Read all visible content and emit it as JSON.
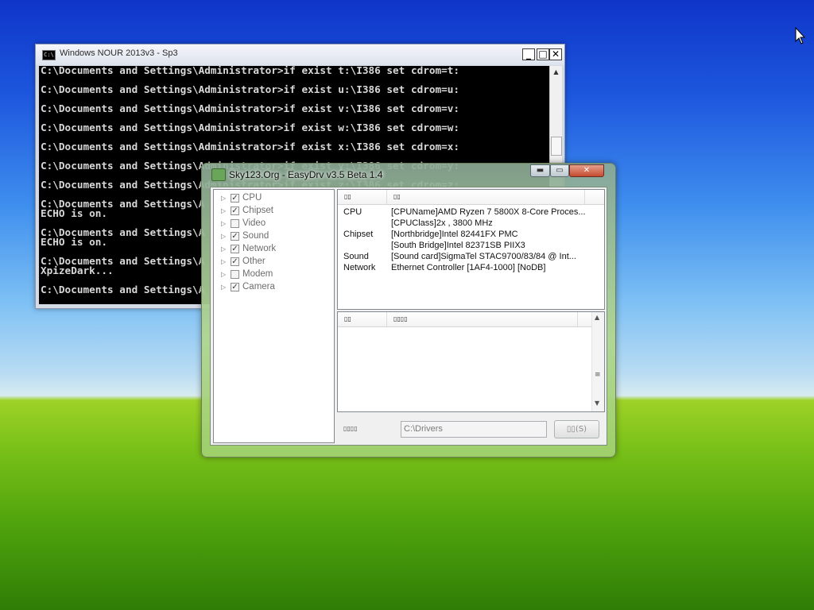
{
  "console": {
    "title": "Windows NOUR 2013v3 - Sp3",
    "icon_text": "C:\\",
    "buttons": {
      "minimize": "_",
      "maximize": "□",
      "close": "✕"
    },
    "lines": [
      "C:\\Documents and Settings\\Administrator>if exist t:\\I386 set cdrom=t:",
      "",
      "C:\\Documents and Settings\\Administrator>if exist u:\\I386 set cdrom=u:",
      "",
      "C:\\Documents and Settings\\Administrator>if exist v:\\I386 set cdrom=v:",
      "",
      "C:\\Documents and Settings\\Administrator>if exist w:\\I386 set cdrom=w:",
      "",
      "C:\\Documents and Settings\\Administrator>if exist x:\\I386 set cdrom=x:",
      "",
      "C:\\Documents and Settings\\Administrator>if exist y:\\I386 set cdrom=y:",
      "",
      "C:\\Documents and Settings\\Administrator>if exist z:\\I386 set cdrom=z:",
      "",
      "C:\\Documents and Settings\\A",
      "ECHO is on.",
      "",
      "C:\\Documents and Settings\\A",
      "ECHO is on.",
      "",
      "C:\\Documents and Settings\\A",
      "XpizeDark...",
      "",
      "C:\\Documents and Settings\\A"
    ]
  },
  "easydrv": {
    "title": "Sky123.Org - EasyDrv v3.5 Beta 1.4",
    "buttons": {
      "minimize": "▬",
      "maximize": "▭",
      "close": "✕"
    },
    "tree": [
      {
        "label": "CPU",
        "checked": true
      },
      {
        "label": "Chipset",
        "checked": true
      },
      {
        "label": "Video",
        "checked": false
      },
      {
        "label": "Sound",
        "checked": true
      },
      {
        "label": "Network",
        "checked": true
      },
      {
        "label": "Other",
        "checked": true
      },
      {
        "label": "Modem",
        "checked": false
      },
      {
        "label": "Camera",
        "checked": true
      }
    ],
    "top_list": {
      "headers": [
        "▯▯",
        "▯▯"
      ],
      "rows": [
        {
          "k": "CPU",
          "v": "[CPUName]AMD Ryzen 7 5800X 8-Core Proces..."
        },
        {
          "k": "",
          "v": "[CPUClass]2x , 3800 MHz"
        },
        {
          "k": "Chipset",
          "v": "[Northbridge]Intel 82441FX PMC"
        },
        {
          "k": "",
          "v": "[South Bridge]Intel 82371SB PIIX3"
        },
        {
          "k": "Sound",
          "v": "[Sound card]SigmaTel STAC9700/83/84 @ Int..."
        },
        {
          "k": "Network",
          "v": "Ethernet Controller [1AF4-1000] [NoDB]"
        }
      ]
    },
    "bottom_list": {
      "headers": [
        "▯▯",
        "▯▯▯▯"
      ]
    },
    "footer": {
      "label": "▯▯▯▯",
      "path_value": "C:\\Drivers",
      "save_button": "▯▯(S)"
    }
  }
}
